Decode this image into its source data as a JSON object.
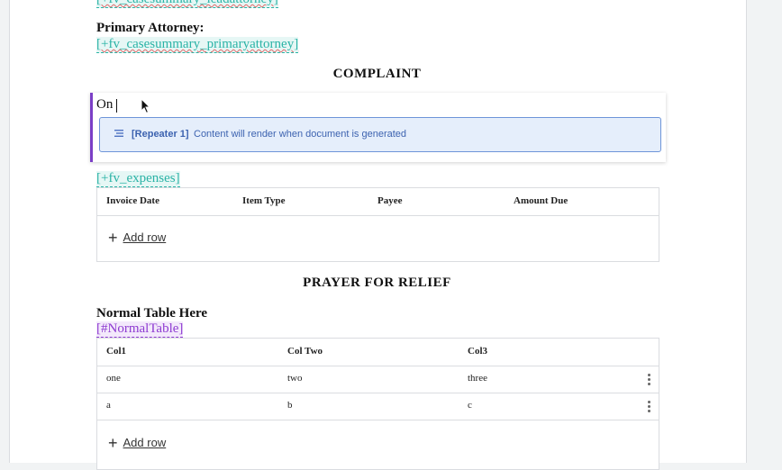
{
  "doc": {
    "top_merge_field": "[+fv_casesummary_leadattorney]",
    "primary_attorney_label": "Primary Attorney:",
    "primary_attorney_field": "[+fv_casesummary_primaryattorney]",
    "complaint_heading": "COMPLAINT",
    "repeater_text": "On",
    "repeater_name": "[Repeater 1]",
    "repeater_message": "Content will render when document is generated",
    "expenses_field": "[+fv_expenses]",
    "expenses_table": {
      "headers": [
        "Invoice Date",
        "Item Type",
        "Payee",
        "Amount Due"
      ],
      "add_row_label": "Add row"
    },
    "prayer_heading": "PRAYER FOR RELIEF",
    "normal_table_title": "Normal Table Here",
    "normal_table_field": "[#NormalTable]",
    "normal_table": {
      "headers": [
        "Col1",
        "Col Two",
        "Col3"
      ],
      "rows": [
        [
          "one",
          "two",
          "three"
        ],
        [
          "a",
          "b",
          "c"
        ]
      ],
      "add_row_label": "Add row"
    }
  },
  "colors": {
    "merge_field": "#2bb3a6",
    "normal_table_field": "#8e3bd1",
    "repeater_accent": "#7b3fc6",
    "repeater_bg": "#e5eefb"
  }
}
